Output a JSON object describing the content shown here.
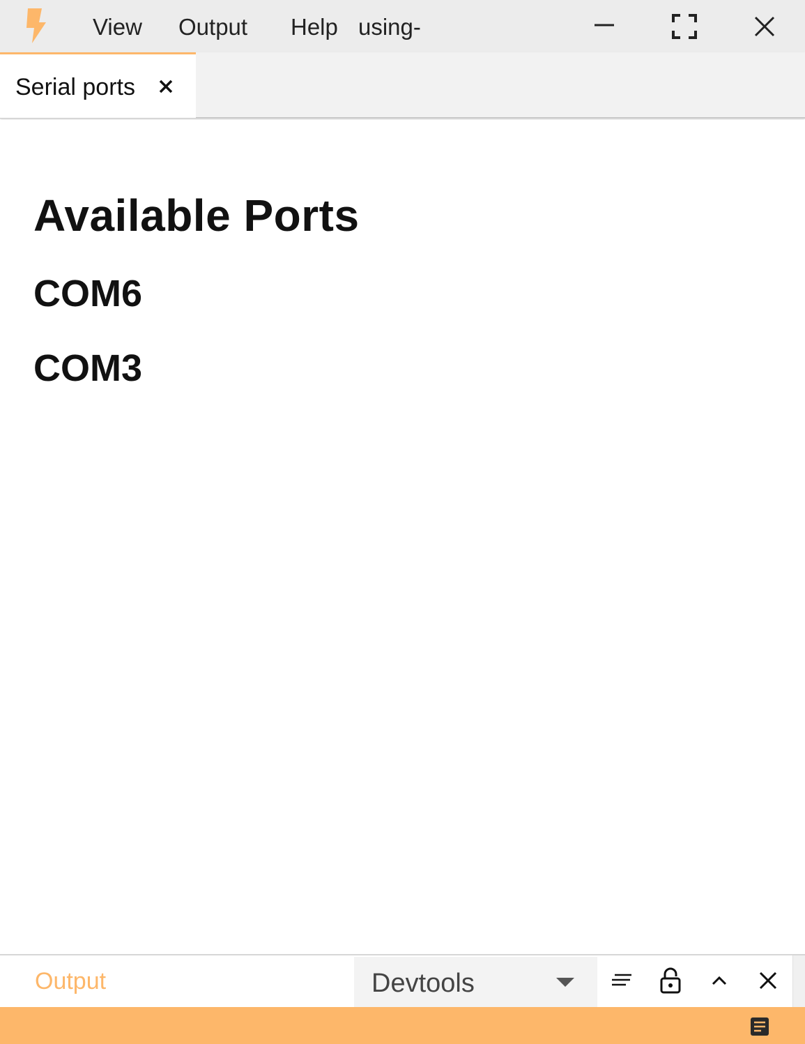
{
  "titlebar": {
    "logo_icon": "lightning-bolt-icon",
    "accent_color": "#fdb76a",
    "menu": [
      "View",
      "Output",
      "Help"
    ],
    "window_title": "using-",
    "controls": [
      "minimize-icon",
      "fullscreen-icon",
      "close-icon"
    ]
  },
  "tabs": [
    {
      "label": "Serial ports",
      "active": true,
      "close_icon": "close-icon"
    }
  ],
  "main": {
    "title": "Available Ports",
    "ports": [
      "COM6",
      "COM3"
    ]
  },
  "bottom_panel": {
    "tab_label": "Output",
    "select_value": "Devtools",
    "buttons": [
      "clear-lines-icon",
      "lock-open-icon",
      "chevron-up-icon",
      "close-icon"
    ]
  },
  "statusbar": {
    "color": "#fdb76a",
    "icon": "notes-icon"
  }
}
